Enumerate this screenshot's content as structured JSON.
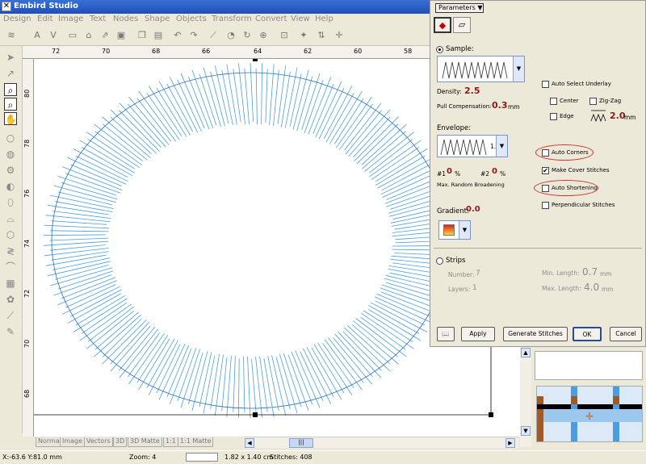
{
  "window": {
    "title": "Embird Studio"
  },
  "menu": [
    "Design",
    "Edit",
    "Image",
    "Text",
    "Nodes",
    "Shape",
    "Objects",
    "Transform",
    "Convert",
    "View",
    "Help"
  ],
  "rulers": {
    "top": [
      "72",
      "70",
      "68",
      "66",
      "64",
      "62",
      "60",
      "58"
    ],
    "left": [
      "80",
      "78",
      "76",
      "74",
      "72",
      "70",
      "68"
    ]
  },
  "bottom_tabs": [
    "Normal",
    "Image",
    "Vectors",
    "3D",
    "3D Matte",
    "1:1",
    "1:1 Matte"
  ],
  "status": {
    "coords": "X:-63.6  Y:81.0 mm",
    "zoom": "Zoom: 4",
    "size": "1.82 x 1.40 cm",
    "stitches": "Stitches: 408"
  },
  "panel": {
    "parameters_label": "Parameters",
    "sample_label": "Sample:",
    "density_label": "Density:",
    "density_value": "2.5",
    "pull_comp_label": "Pull Compensation:",
    "pull_comp_value": "0.3",
    "pull_comp_unit": "mm",
    "envelope_label": "Envelope:",
    "envelope_value": "1.",
    "broadening_1": "#1",
    "broadening_1_value": "0",
    "broadening_2": "#2",
    "broadening_2_value": "0",
    "percent": "%",
    "broadening_label": "Max. Random Broadening",
    "gradient_label": "Gradient:",
    "gradient_value": "0.0",
    "auto_select_underlay": "Auto Select Underlay",
    "center": "Center",
    "zigzag": "Zig-Zag",
    "edge": "Edge",
    "underlay_value": "2.0",
    "underlay_unit": "mm",
    "auto_corners": "Auto Corners",
    "make_cover_stitches": "Make Cover Stitches",
    "auto_shortening": "Auto Shortening",
    "perpendicular_stitches": "Perpendicular Stitches",
    "strips_label": "Strips",
    "number_label": "Number:",
    "number_value": "7",
    "layers_label": "Layers:",
    "layers_value": "1",
    "min_length_label": "Min. Length:",
    "min_length_value": "0.7",
    "max_length_label": "Max. Length:",
    "max_length_value": "4.0",
    "length_unit": "mm",
    "apply": "Apply",
    "generate_stitches": "Generate Stitches",
    "ok": "OK",
    "cancel": "Cancel"
  },
  "colors": {
    "stitch": "#4a9ee0",
    "value_red": "#8b1a1a",
    "annotation": "#d23030"
  }
}
